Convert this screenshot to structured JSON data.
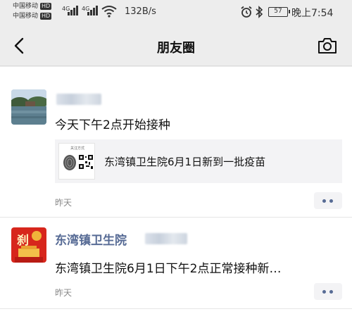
{
  "status_bar": {
    "carrier1": "中国移动",
    "carrier2": "中国移动",
    "hd1": "HD",
    "hd2": "HD",
    "net1": "4G",
    "net2": "4G",
    "speed": "132B/s",
    "battery": "57",
    "time": "晚上7:54",
    "icons": [
      "signal-icon",
      "wifi-icon",
      "alarm-icon",
      "bluetooth-icon",
      "battery-icon"
    ]
  },
  "header": {
    "title": "朋友圈",
    "back_icon": "back-arrow-icon",
    "camera_icon": "camera-icon"
  },
  "posts": [
    {
      "author": "",
      "text": "今天下午2点开始接种",
      "share": {
        "thumb_label": "关注方式",
        "title": "东湾镇卫生院6月1日新到一批疫苗"
      },
      "time": "昨天"
    },
    {
      "author": "东湾镇卫生院",
      "avatar_text": "刹",
      "text": "东湾镇卫生院6月1日下午2点正常接种新…",
      "time": "昨天"
    }
  ],
  "colors": {
    "name_link": "#576b95",
    "background": "#ededed",
    "card": "#f3f3f5"
  }
}
